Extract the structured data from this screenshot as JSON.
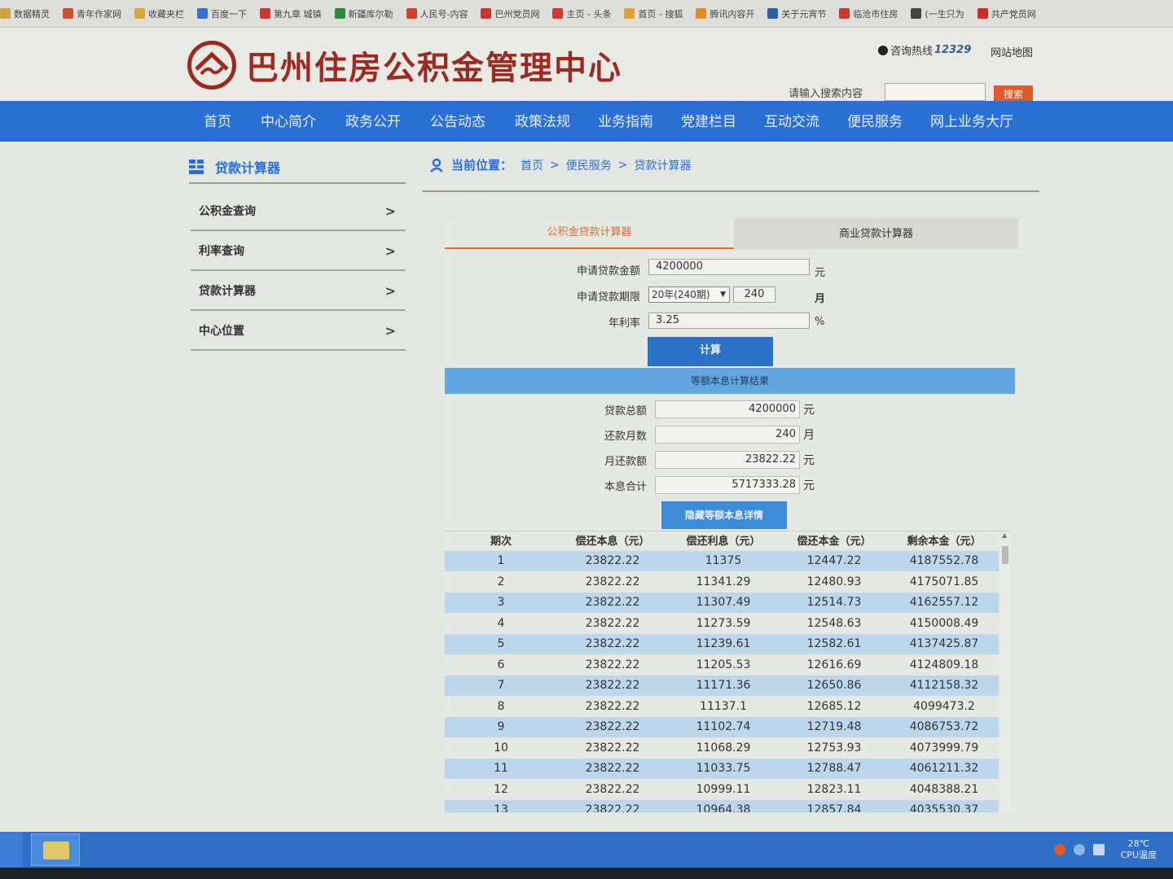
{
  "bookmarks": [
    {
      "label": "数据精灵",
      "color": "#c9a53a"
    },
    {
      "label": "青年作家网",
      "color": "#d0502e"
    },
    {
      "label": "收藏夹栏",
      "color": "#d9a93b"
    },
    {
      "label": "百度一下",
      "color": "#3b6fd0"
    },
    {
      "label": "第九章 城镇",
      "color": "#c83a2e"
    },
    {
      "label": "新疆库尔勒",
      "color": "#2d8a3e"
    },
    {
      "label": "人民号-内容",
      "color": "#d6402a"
    },
    {
      "label": "巴州党员网",
      "color": "#c8362a"
    },
    {
      "label": "主页 - 头条",
      "color": "#d03c2c"
    },
    {
      "label": "首页 - 搜狐",
      "color": "#e0a22e"
    },
    {
      "label": "腾讯内容开",
      "color": "#e08a22"
    },
    {
      "label": "关于元宵节",
      "color": "#2b5fa8"
    },
    {
      "label": "临沧市住房",
      "color": "#c83a2a"
    },
    {
      "label": "(一生只为",
      "color": "#444444"
    },
    {
      "label": "共产党员网",
      "color": "#c8302a"
    }
  ],
  "header": {
    "site_title": "巴州住房公积金管理中心",
    "hotline_label": "咨询热线",
    "hotline_number": "12329",
    "sitemap": "网站地图",
    "search_label": "请输入搜索内容",
    "search_placeholder": "",
    "search_button": "搜索"
  },
  "nav": [
    "首页",
    "中心简介",
    "政务公开",
    "公告动态",
    "政策法规",
    "业务指南",
    "党建栏目",
    "互动交流",
    "便民服务",
    "网上业务大厅"
  ],
  "sidebar": {
    "title": "贷款计算器",
    "items": [
      "公积金查询",
      "利率查询",
      "贷款计算器",
      "中心位置"
    ],
    "chevron": ">"
  },
  "breadcrumb": {
    "label": "当前位置：",
    "items": [
      "首页",
      "便民服务",
      "贷款计算器"
    ],
    "sep": ">"
  },
  "calculator": {
    "tabs": [
      "公积金贷款计算器",
      "商业贷款计算器"
    ],
    "amount_label": "申请贷款金额",
    "amount_value": "4200000",
    "amount_unit": "元",
    "term_label": "申请贷款期限",
    "term_select": "20年(240期)",
    "term_value": "240",
    "term_unit": "月",
    "rate_label": "年利率",
    "rate_value": "3.25",
    "rate_unit": "%",
    "calc_button": "计算",
    "result_title": "等额本息计算结果",
    "results": [
      {
        "label": "贷款总额",
        "value": "4200000",
        "unit": "元"
      },
      {
        "label": "还款月数",
        "value": "240",
        "unit": "月"
      },
      {
        "label": "月还款额",
        "value": "23822.22",
        "unit": "元"
      },
      {
        "label": "本息合计",
        "value": "5717333.28",
        "unit": "元"
      }
    ],
    "detail_button": "隐藏等额本息详情"
  },
  "table": {
    "headers": [
      "期次",
      "偿还本息（元）",
      "偿还利息（元）",
      "偿还本金（元）",
      "剩余本金（元）"
    ],
    "rows": [
      [
        "1",
        "23822.22",
        "11375",
        "12447.22",
        "4187552.78"
      ],
      [
        "2",
        "23822.22",
        "11341.29",
        "12480.93",
        "4175071.85"
      ],
      [
        "3",
        "23822.22",
        "11307.49",
        "12514.73",
        "4162557.12"
      ],
      [
        "4",
        "23822.22",
        "11273.59",
        "12548.63",
        "4150008.49"
      ],
      [
        "5",
        "23822.22",
        "11239.61",
        "12582.61",
        "4137425.87"
      ],
      [
        "6",
        "23822.22",
        "11205.53",
        "12616.69",
        "4124809.18"
      ],
      [
        "7",
        "23822.22",
        "11171.36",
        "12650.86",
        "4112158.32"
      ],
      [
        "8",
        "23822.22",
        "11137.1",
        "12685.12",
        "4099473.2"
      ],
      [
        "9",
        "23822.22",
        "11102.74",
        "12719.48",
        "4086753.72"
      ],
      [
        "10",
        "23822.22",
        "11068.29",
        "12753.93",
        "4073999.79"
      ],
      [
        "11",
        "23822.22",
        "11033.75",
        "12788.47",
        "4061211.32"
      ],
      [
        "12",
        "23822.22",
        "10999.11",
        "12823.11",
        "4048388.21"
      ],
      [
        "13",
        "23822.22",
        "10964.38",
        "12857.84",
        "4035530.37"
      ]
    ]
  },
  "taskbar": {
    "temp": "28℃",
    "cpu": "CPU温度"
  },
  "colors": {
    "nav_blue": "#2a6fd3",
    "brand_red": "#9a2a22",
    "tab_orange": "#e06a32",
    "row_blue": "#bcd6ec"
  }
}
